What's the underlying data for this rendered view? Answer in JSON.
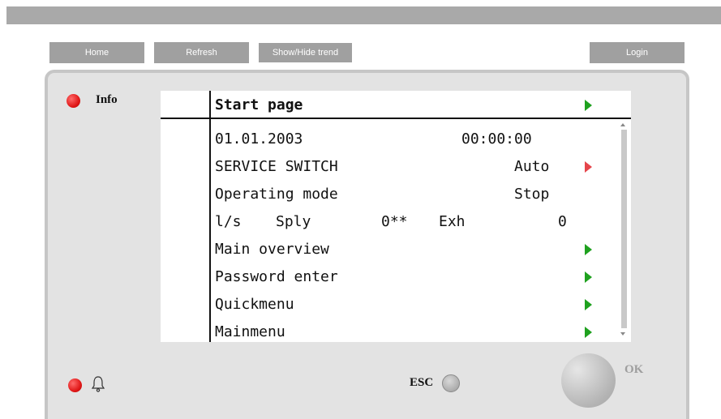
{
  "nav": {
    "home": "Home",
    "refresh": "Refresh",
    "trend": "Show/Hide trend",
    "login": "Login"
  },
  "panel": {
    "info_label": "Info",
    "esc_label": "ESC",
    "ok_label": "OK"
  },
  "screen": {
    "header": "Start page",
    "date": "01.01.2003",
    "time": "00:00:00",
    "service_switch": {
      "label": "SERVICE SWITCH",
      "value": "Auto"
    },
    "operating_mode": {
      "label": "Operating mode",
      "value": "Stop"
    },
    "flow": {
      "unit": "l/s",
      "sply_label": "Sply",
      "sply_value": "0**",
      "exh_label": "Exh",
      "exh_value": "0"
    },
    "main_overview": "Main overview",
    "password_enter": "Password enter",
    "quickmenu": "Quickmenu",
    "mainmenu": "Mainmenu"
  },
  "colors": {
    "led_red": "#e11919",
    "arrow_green": "#1fa11f",
    "arrow_red": "#e5454b",
    "button_gray": "#a0a0a0"
  },
  "icons": [
    "bell-icon",
    "led-indicator",
    "nav-arrow-icon"
  ]
}
